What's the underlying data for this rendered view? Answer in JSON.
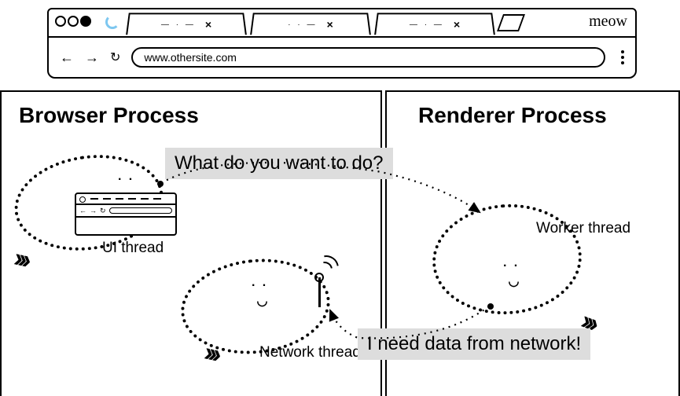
{
  "browser": {
    "traffic_lights": 3,
    "loading_spinner": true,
    "tabs": [
      {
        "title_glyph": "— · —",
        "close": "×"
      },
      {
        "title_glyph": "· · —",
        "close": "×"
      },
      {
        "title_glyph": "— · —",
        "close": "×"
      }
    ],
    "brand_text": "meow",
    "nav": {
      "back": "←",
      "forward": "→",
      "reload": "↻"
    },
    "url": "www.othersite.com"
  },
  "processes": {
    "browser_process": {
      "title": "Browser Process"
    },
    "renderer_process": {
      "title": "Renderer Process"
    }
  },
  "threads": {
    "ui": {
      "label": "UI thread"
    },
    "network": {
      "label": "Network thread"
    },
    "worker": {
      "label": "Worker thread"
    }
  },
  "messages": {
    "renderer_asks": "What do you want to do?",
    "worker_replies": "I need data from network!"
  }
}
